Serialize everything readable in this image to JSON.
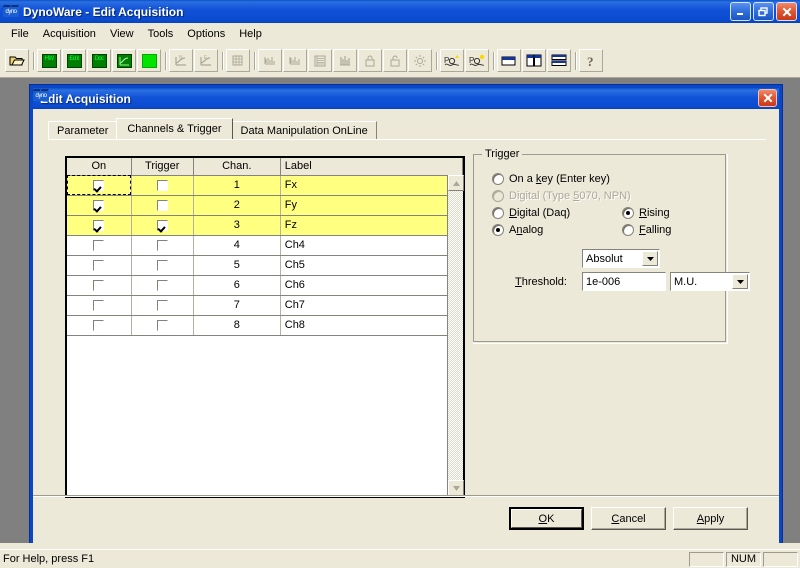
{
  "window": {
    "title": "DynoWare - Edit Acquisition",
    "icon": "dyno-logo-icon",
    "controls": [
      {
        "name": "minimize-button",
        "glyph": "minimize"
      },
      {
        "name": "restore-button",
        "glyph": "restore"
      },
      {
        "name": "close-button",
        "glyph": "close"
      }
    ]
  },
  "menubar": {
    "items": [
      {
        "label": "File"
      },
      {
        "label": "Acquisition"
      },
      {
        "label": "View"
      },
      {
        "label": "Tools"
      },
      {
        "label": "Options"
      },
      {
        "label": "Help"
      }
    ]
  },
  "toolbar": {
    "buttons": [
      {
        "name": "open-file-button",
        "icon": "open-folder-icon",
        "label": "",
        "enabled": true,
        "kind": "folder"
      },
      {
        "name": "hardware-button",
        "icon": "hardware-icon",
        "label": "HW",
        "enabled": true,
        "kind": "green-label"
      },
      {
        "name": "edit-acquisition-button",
        "icon": "edit-acquisition-icon",
        "label": "Ed it",
        "enabled": true,
        "kind": "green-label"
      },
      {
        "name": "document-button",
        "icon": "document-icon",
        "label": "Doc",
        "enabled": true,
        "kind": "green-label"
      },
      {
        "name": "graph-button",
        "icon": "graph-icon",
        "label": "",
        "enabled": true,
        "kind": "green-graph"
      },
      {
        "name": "start-button",
        "icon": "green-square-icon",
        "label": "",
        "enabled": true,
        "kind": "solid-green"
      },
      {
        "name": "curve-n-button",
        "icon": "curve-n-icon",
        "label": "",
        "enabled": false,
        "kind": "graph-dis"
      },
      {
        "name": "curve-e-button",
        "icon": "curve-e-icon",
        "label": "",
        "enabled": false,
        "kind": "graph-dis"
      },
      {
        "name": "matrix-button",
        "icon": "matrix-icon",
        "label": "",
        "enabled": false,
        "kind": "grid-dis"
      },
      {
        "name": "data-a-button",
        "icon": "data-a-icon",
        "label": "",
        "enabled": false,
        "kind": "grid-dis"
      },
      {
        "name": "data-b-button",
        "icon": "data-b-icon",
        "label": "",
        "enabled": false,
        "kind": "grid-dis"
      },
      {
        "name": "list-button",
        "icon": "list-icon",
        "label": "",
        "enabled": false,
        "kind": "list-dis"
      },
      {
        "name": "histogram-button",
        "icon": "histogram-icon",
        "label": "",
        "enabled": false,
        "kind": "hist-dis"
      },
      {
        "name": "lock-button",
        "icon": "lock-closed-icon",
        "label": "",
        "enabled": false,
        "kind": "lock-dis"
      },
      {
        "name": "unlock-button",
        "icon": "lock-open-icon",
        "label": "",
        "enabled": false,
        "kind": "lock-dis"
      },
      {
        "name": "sun-button",
        "icon": "sun-icon",
        "label": "",
        "enabled": false,
        "kind": "sun-dis"
      },
      {
        "name": "cursor-a-button",
        "icon": "cursor-wave-a-icon",
        "label": "",
        "enabled": true,
        "kind": "wave"
      },
      {
        "name": "cursor-b-button",
        "icon": "cursor-wave-b-icon",
        "label": "",
        "enabled": true,
        "kind": "wave"
      },
      {
        "name": "window-cascade-button",
        "icon": "window-cascade-icon",
        "label": "",
        "enabled": true,
        "kind": "win1"
      },
      {
        "name": "window-tile-vertical-button",
        "icon": "window-tile-vertical-icon",
        "label": "",
        "enabled": true,
        "kind": "win2"
      },
      {
        "name": "window-tile-horizontal-button",
        "icon": "window-tile-horizontal-icon",
        "label": "",
        "enabled": true,
        "kind": "win3"
      },
      {
        "name": "help-button",
        "icon": "question-mark-icon",
        "label": "",
        "enabled": true,
        "kind": "help"
      }
    ]
  },
  "dialog": {
    "title": "Edit Acquisition",
    "icon": "dyno-logo-icon",
    "close_label": "",
    "tabs": [
      {
        "label": "Parameter",
        "active": false
      },
      {
        "label": "Channels & Trigger",
        "active": true
      },
      {
        "label": "Data Manipulation OnLine",
        "active": false
      }
    ],
    "table": {
      "columns": [
        "On",
        "Trigger",
        "Chan.",
        "Label"
      ],
      "rows": [
        {
          "on": true,
          "trigger": false,
          "chan": "1",
          "label": "Fx",
          "selected": true,
          "focused": true
        },
        {
          "on": true,
          "trigger": false,
          "chan": "2",
          "label": "Fy",
          "selected": true,
          "focused": false
        },
        {
          "on": true,
          "trigger": true,
          "chan": "3",
          "label": "Fz",
          "selected": true,
          "focused": false
        },
        {
          "on": false,
          "trigger": false,
          "chan": "4",
          "label": "Ch4",
          "selected": false,
          "focused": false
        },
        {
          "on": false,
          "trigger": false,
          "chan": "5",
          "label": "Ch5",
          "selected": false,
          "focused": false
        },
        {
          "on": false,
          "trigger": false,
          "chan": "6",
          "label": "Ch6",
          "selected": false,
          "focused": false
        },
        {
          "on": false,
          "trigger": false,
          "chan": "7",
          "label": "Ch7",
          "selected": false,
          "focused": false
        },
        {
          "on": false,
          "trigger": false,
          "chan": "8",
          "label": "Ch8",
          "selected": false,
          "focused": false
        }
      ],
      "scrollbar": {
        "up": "▲",
        "down": "▼"
      }
    },
    "trigger": {
      "legend": "Trigger",
      "source_options": [
        {
          "label_pre": "On a ",
          "label_key": "k",
          "label_post": "ey (Enter key)",
          "selected": false,
          "enabled": true,
          "name": "radio-on-a-key"
        },
        {
          "label_pre": "Digital (Type ",
          "label_key": "5",
          "label_post": "070, NPN)",
          "selected": false,
          "enabled": false,
          "name": "radio-digital-5070"
        },
        {
          "label_pre": "",
          "label_key": "D",
          "label_post": "igital (Daq)",
          "selected": false,
          "enabled": true,
          "name": "radio-digital-daq"
        },
        {
          "label_pre": "A",
          "label_key": "n",
          "label_post": "alog",
          "selected": true,
          "enabled": true,
          "name": "radio-analog"
        }
      ],
      "edge_options": [
        {
          "label_pre": "",
          "label_key": "R",
          "label_post": "ising",
          "selected": true,
          "enabled": true,
          "name": "radio-rising"
        },
        {
          "label_pre": "",
          "label_key": "F",
          "label_post": "alling",
          "selected": false,
          "enabled": true,
          "name": "radio-falling"
        }
      ],
      "mode_combo": {
        "value": "Absolut",
        "name": "trigger-mode-combo"
      },
      "threshold_label_pre": "",
      "threshold_label_key": "T",
      "threshold_label_post": "hreshold:",
      "threshold_value": "1e-006",
      "unit_combo": {
        "value": "M.U.",
        "name": "trigger-unit-combo"
      }
    },
    "buttons": [
      {
        "name": "ok-button",
        "pre": "",
        "key": "O",
        "post": "K",
        "default": true
      },
      {
        "name": "cancel-button",
        "pre": "",
        "key": "C",
        "post": "ancel",
        "default": false
      },
      {
        "name": "apply-button",
        "pre": "",
        "key": "A",
        "post": "pply",
        "default": false
      }
    ]
  },
  "statusbar": {
    "message": "For Help, press F1",
    "panes": [
      "",
      "NUM",
      ""
    ]
  },
  "colors": {
    "titlebar_blue": "#0a53c8",
    "dialog_border": "#0a46c8",
    "face": "#ece9d8",
    "mdi_background": "#808080",
    "row_highlight": "#ffff80",
    "toolbar_green": "#007f00",
    "close_red": "#e05a34"
  }
}
